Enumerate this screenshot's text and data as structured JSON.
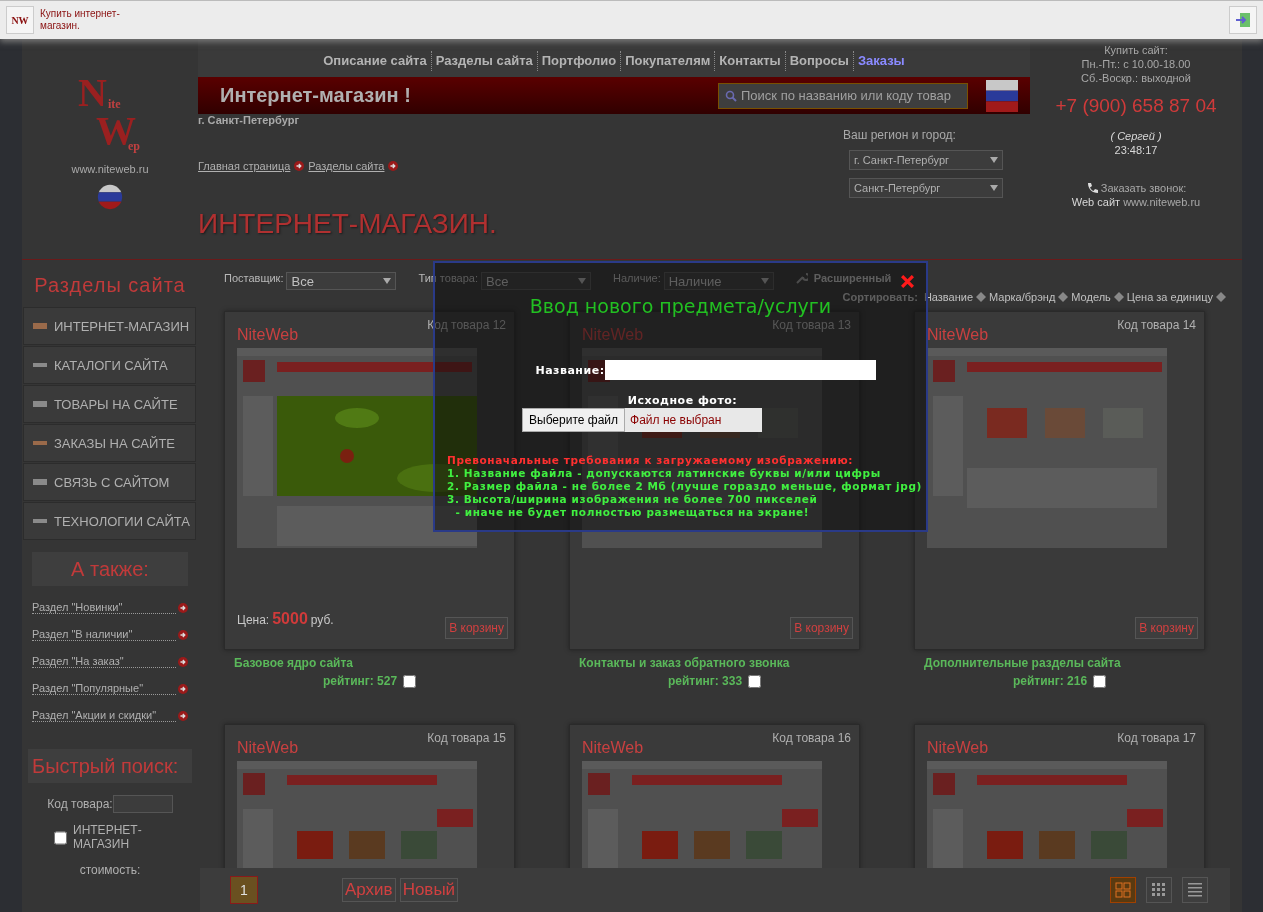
{
  "top_bar": {
    "logo_text": "NW",
    "text": "Купить интернет-магазин."
  },
  "header": {
    "logo": [
      "N",
      "ite",
      "W",
      "ep"
    ],
    "site_url": "www.niteweb.ru",
    "nav": [
      {
        "label": "Описание сайта",
        "selected": false
      },
      {
        "label": "Разделы сайта",
        "selected": false
      },
      {
        "label": "Портфолио",
        "selected": false
      },
      {
        "label": "Покупателям",
        "selected": false
      },
      {
        "label": "Контакты",
        "selected": false
      },
      {
        "label": "Вопросы",
        "selected": false
      },
      {
        "label": "Заказы",
        "selected": true
      }
    ],
    "banner_title": "Интернет-магазин !",
    "search": {
      "placeholder": "Поиск по названию или коду товар"
    },
    "city": "г. Санкт-Петербург",
    "breadcrumbs": [
      "Главная страница",
      "Разделы сайта"
    ],
    "page_title": "ИНТЕРНЕТ-МАГАЗИН.",
    "region": {
      "label": "Ваш регион и город:",
      "selects": [
        "г. Санкт-Петербург",
        "Санкт-Петербург"
      ]
    },
    "contact": {
      "buy_title": "Купить сайт:",
      "hours": [
        "Пн.-Пт.: с 10.00-18.00",
        "Сб.-Воскр.: выходной"
      ],
      "phone": "+7 (900) 658 87 04",
      "person": "( Сергей )",
      "time": "23:48:17",
      "callback": "Заказать звонок:",
      "web_label": "Web сайт",
      "web_url": "www.niteweb.ru"
    }
  },
  "sidebar": {
    "title": "Разделы сайта",
    "items": [
      "ИНТЕРНЕТ-МАГАЗИН",
      "КАТАЛОГИ САЙТА",
      "ТОВАРЫ НА САЙТЕ",
      "ЗАКАЗЫ НА САЙТЕ",
      "СВЯЗЬ С САЙТОМ",
      "ТЕХНОЛОГИИ САЙТА"
    ],
    "also_title": "А также:",
    "also_links": [
      "Раздел \"Новинки\"",
      "Раздел \"В наличии\"",
      "Раздел \"На заказ\"",
      "Раздел \"Популярные\"",
      "Раздел \"Акции и скидки\""
    ],
    "quick_search": {
      "title": "Быстрый поиск:",
      "code_label": "Код товара:",
      "category": {
        "label": "ИНТЕРНЕТ-МАГАЗИН",
        "checked": false
      },
      "cost_label": "стоимость:"
    }
  },
  "filters": [
    {
      "label": "Поставщик:",
      "value": "Все"
    },
    {
      "label": "Тип товара:",
      "value": "Все"
    },
    {
      "label": "Наличие:",
      "value": "Наличие"
    }
  ],
  "advanced_search": "Расширенный",
  "sort": {
    "label": "Сортировать:",
    "options": [
      "Название",
      "Марка/брэнд",
      "Модель",
      "Цена за единицу"
    ]
  },
  "products": [
    {
      "code": "Код товара 12",
      "brand": "NiteWeb",
      "kind": "green",
      "price_label": "Цена:",
      "price": "5000",
      "currency": "руб.",
      "cart": "В корзину",
      "name": "Базовое ядро сайта",
      "rating": "рейтинг: 527",
      "checked": false
    },
    {
      "code": "Код товара 13",
      "brand": "NiteWeb",
      "kind": "site",
      "cart": "В корзину",
      "name": "Контакты и заказ обратного звонка",
      "rating": "рейтинг: 333",
      "checked": false
    },
    {
      "code": "Код товара 14",
      "brand": "NiteWeb",
      "kind": "site",
      "cart": "В корзину",
      "name": "Дополнительные разделы сайта",
      "rating": "рейтинг: 216",
      "checked": false
    },
    {
      "code": "Код товара 15",
      "brand": "NiteWeb",
      "kind": "gallery"
    },
    {
      "code": "Код товара 16",
      "brand": "NiteWeb",
      "kind": "gallery"
    },
    {
      "code": "Код товара 17",
      "brand": "NiteWeb",
      "kind": "gallery"
    }
  ],
  "pager": {
    "pages": [
      {
        "label": "1",
        "selected": true
      }
    ],
    "buttons": [
      "Архив",
      "Новый"
    ],
    "views": [
      {
        "kind": "grid",
        "selected": true
      },
      {
        "kind": "grid-small",
        "selected": false
      },
      {
        "kind": "list",
        "selected": false
      }
    ]
  },
  "modal": {
    "title": "Ввод нового предмета/услуги",
    "name_label": "Название:",
    "photo_label": "Исходное фото:",
    "file_button": "Выберите файл",
    "file_status": "Файл не выбран",
    "requirements_title": "Превоначальные требования к загружаемому изображению:",
    "requirements": [
      "1. Название файла - допускаются латинские буквы и/или цифры",
      "2. Размер файла - не более 2 Мб (лучше гораздо меньше, формат jpg)",
      "3. Высота/ширина изображения не более 700 пикселей",
      "  - иначе не будет полностью размещаться на экране!"
    ]
  }
}
